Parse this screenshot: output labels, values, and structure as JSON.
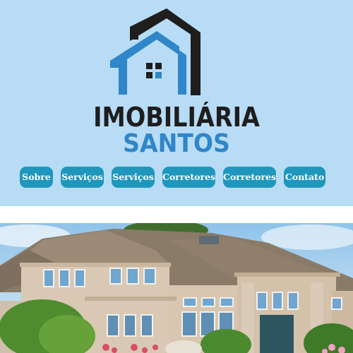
{
  "brand": {
    "line1": "IMOBILIÁRIA",
    "line2": "SANTOS"
  },
  "nav": {
    "items": [
      {
        "label": "Sobre"
      },
      {
        "label": "Serviços"
      },
      {
        "label": "Serviços"
      },
      {
        "label": "Corretores"
      },
      {
        "label": "Corretores"
      },
      {
        "label": "Contato"
      }
    ]
  },
  "colors": {
    "header_bg": "#b8dcf6",
    "button_bg": "#1f97bd",
    "brand_dark": "#1e1e1e",
    "brand_blue": "#2f86c8"
  },
  "hero": {
    "image": "house-photo"
  }
}
